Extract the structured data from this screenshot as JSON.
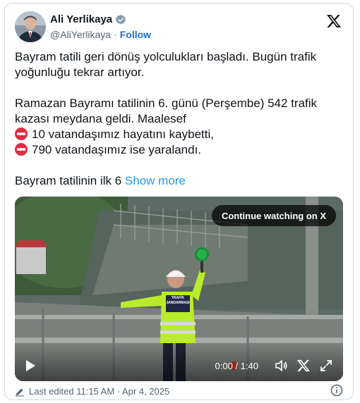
{
  "author": {
    "name": "Ali Yerlikaya",
    "handle": "@AliYerlikaya",
    "separator": "·",
    "follow_label": "Follow"
  },
  "tweet": {
    "line1": "Bayram tatili geri dönüş yolculukları başladı. Bugün trafik yoğunluğu tekrar artıyor.",
    "line2": "Ramazan Bayramı tatilinin 6. günü (Perşembe) 542 trafik kazası meydana geldi. Maalesef",
    "line3": "10 vatandaşımız hayatını kaybetti,",
    "line4": "790 vatandaşımız ise yaralandı.",
    "line5": "Bayram tatilinin ilk 6",
    "show_more": "Show more"
  },
  "video": {
    "continue_label": "Continue watching on X",
    "time": "0:00 / 1:40",
    "sign_text_1": "TRAFİK",
    "sign_text_2": "JANDARMASI"
  },
  "footer": {
    "edited": "Last edited 11:15 AM · Apr 4, 2025"
  },
  "icons": {
    "verified": "verified-badge-icon",
    "x_logo": "x-logo-icon",
    "no_entry": "no-entry-emoji-icon",
    "play": "play-icon",
    "volume": "volume-icon",
    "close": "close-icon",
    "fullscreen": "fullscreen-icon",
    "pencil": "pencil-icon",
    "info": "info-icon"
  },
  "colors": {
    "link": "#1d9bf0",
    "follow": "#1d6ec6",
    "verified": "#829aab",
    "no_entry": "#dd2e44"
  }
}
